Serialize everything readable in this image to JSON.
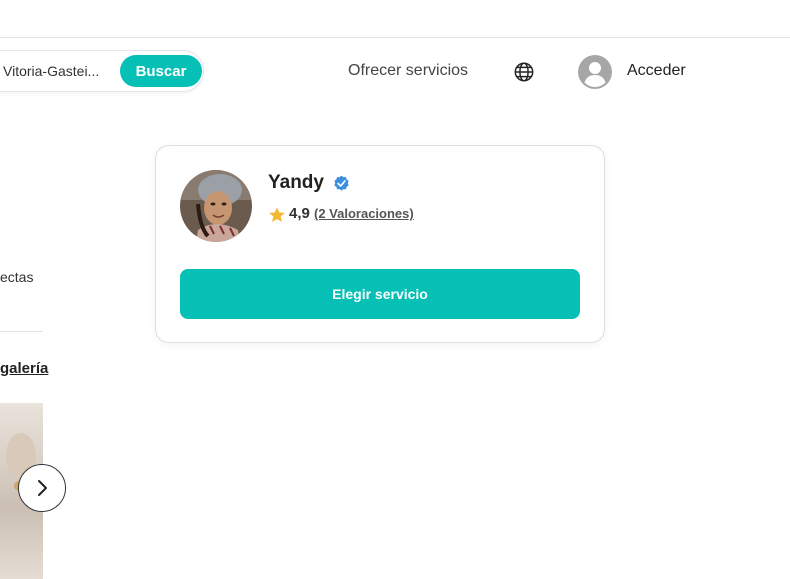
{
  "header": {
    "search_location": "Vitoria-Gastei...",
    "search_button": "Buscar",
    "offer_services": "Ofrecer servicios",
    "globe_icon": "globe-icon",
    "user_icon": "user-avatar-icon",
    "login": "Acceder"
  },
  "left_panel": {
    "cut_text": "ectas",
    "gallery_link": "galería",
    "next_icon": "chevron-right-icon"
  },
  "provider_card": {
    "name": "Yandy",
    "verified_icon": "verified-check-icon",
    "star_icon": "star-icon",
    "rating": "4,9",
    "reviews": "(2 Valoraciones)",
    "choose_button": "Elegir servicio"
  },
  "colors": {
    "accent": "#06bfb5",
    "verified": "#3b8fe0",
    "star": "#f5b731"
  }
}
